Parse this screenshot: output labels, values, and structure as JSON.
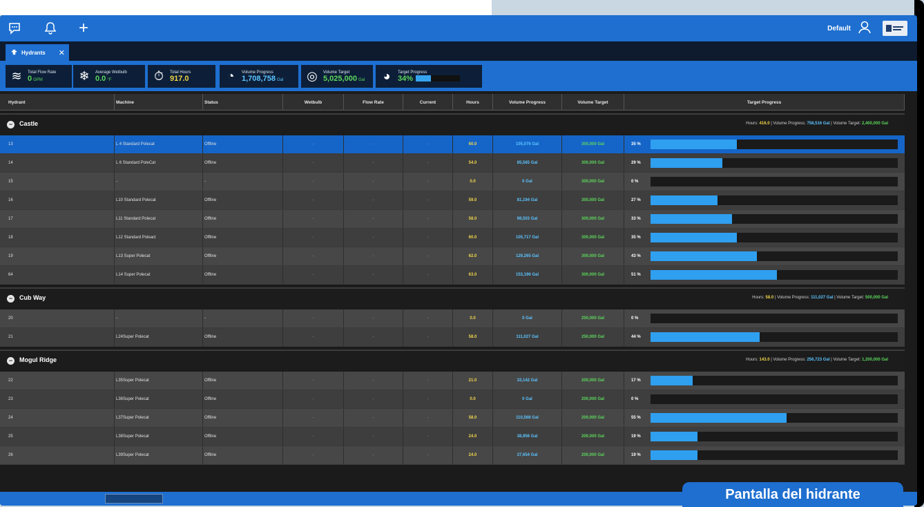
{
  "topbar": {
    "profile_name": "Default",
    "icons": [
      "chat-icon",
      "bell-icon",
      "plus-icon",
      "user-icon"
    ],
    "brand_color": "#1e6fd0"
  },
  "tab": {
    "label": "Hydrants",
    "close": "✕"
  },
  "kpis": [
    {
      "label": "Total Flow Rate",
      "value": "0",
      "unit": "GPM",
      "color": "#5cd65c",
      "icon": "waves-icon"
    },
    {
      "label": "Average Wetbulb",
      "value": "0.0",
      "unit": "°F",
      "color": "#5cd65c",
      "icon": "snowflake-icon"
    },
    {
      "label": "Total Hours",
      "value": "917.0",
      "unit": "",
      "color": "#f1d54a",
      "icon": "stopwatch-icon"
    },
    {
      "label": "Volume Progress",
      "value": "1,708,758",
      "unit": "Gal",
      "color": "#5cc4ff",
      "icon": "gauge-icon"
    },
    {
      "label": "Volume Target",
      "value": "5,025,000",
      "unit": "Gal",
      "color": "#5cd65c",
      "icon": "target-icon"
    },
    {
      "label": "Target Progress",
      "value": "34%",
      "unit": "",
      "color": "#5cd65c",
      "icon": "gauge-check-icon",
      "progress": 0.34
    }
  ],
  "columns": [
    "Hydrant",
    "Machine",
    "Status",
    "Wetbulb",
    "Flow Rate",
    "Current",
    "Hours",
    "Volume Progress",
    "Volume Target",
    "Target Progress"
  ],
  "groups": [
    {
      "name": "Castle",
      "summary": {
        "hours_label": "Hours:",
        "hours": "416.0",
        "vol_label": "Volume Progress:",
        "vol": "758,516 Gal",
        "tgt_label": "Volume Target:",
        "tgt": "2,400,000 Gal"
      },
      "rows": [
        {
          "hydrant": "13",
          "machine": "L 4 Standard Polecat",
          "status": "Offline",
          "wetbulb": "-",
          "flow": "-",
          "current": "-",
          "hours": "60.0",
          "vol": "105,076 Gal",
          "tgt": "300,000 Gal",
          "pct": "35 %",
          "progress": 0.35,
          "selected": true
        },
        {
          "hydrant": "14",
          "machine": "L 6 Standard PoleCat",
          "status": "Offline",
          "wetbulb": "-",
          "flow": "-",
          "current": "-",
          "hours": "54.0",
          "vol": "85,565 Gal",
          "tgt": "300,000 Gal",
          "pct": "29 %",
          "progress": 0.29
        },
        {
          "hydrant": "15",
          "machine": "-",
          "status": "-",
          "wetbulb": "-",
          "flow": "-",
          "current": "-",
          "hours": "0.0",
          "vol": "0 Gal",
          "tgt": "300,000 Gal",
          "pct": "0 %",
          "progress": 0
        },
        {
          "hydrant": "16",
          "machine": "L10 Standard Polecat",
          "status": "Offline",
          "wetbulb": "-",
          "flow": "-",
          "current": "-",
          "hours": "59.0",
          "vol": "81,194 Gal",
          "tgt": "300,000 Gal",
          "pct": "27 %",
          "progress": 0.27
        },
        {
          "hydrant": "17",
          "machine": "L11 Standard Polecat",
          "status": "Offline",
          "wetbulb": "-",
          "flow": "-",
          "current": "-",
          "hours": "58.0",
          "vol": "98,503 Gal",
          "tgt": "300,000 Gal",
          "pct": "33 %",
          "progress": 0.33
        },
        {
          "hydrant": "18",
          "machine": "L12 Standard Poleact",
          "status": "Offline",
          "wetbulb": "-",
          "flow": "-",
          "current": "-",
          "hours": "60.0",
          "vol": "105,717 Gal",
          "tgt": "300,000 Gal",
          "pct": "35 %",
          "progress": 0.35
        },
        {
          "hydrant": "19",
          "machine": "L13 Super Polecat",
          "status": "Offline",
          "wetbulb": "-",
          "flow": "-",
          "current": "-",
          "hours": "62.0",
          "vol": "129,265 Gal",
          "tgt": "300,000 Gal",
          "pct": "43 %",
          "progress": 0.43
        },
        {
          "hydrant": "64",
          "machine": "L14 Super Polecat",
          "status": "Offline",
          "wetbulb": "-",
          "flow": "-",
          "current": "-",
          "hours": "63.0",
          "vol": "153,196 Gal",
          "tgt": "300,000 Gal",
          "pct": "51 %",
          "progress": 0.51
        }
      ]
    },
    {
      "name": "Cub Way",
      "summary": {
        "hours_label": "Hours:",
        "hours": "58.0",
        "vol_label": "Volume Progress:",
        "vol": "111,027 Gal",
        "tgt_label": "Volume Target:",
        "tgt": "500,000 Gal"
      },
      "rows": [
        {
          "hydrant": "20",
          "machine": "-",
          "status": "-",
          "wetbulb": "-",
          "flow": "-",
          "current": "-",
          "hours": "0.0",
          "vol": "0 Gal",
          "tgt": "250,000 Gal",
          "pct": "0 %",
          "progress": 0
        },
        {
          "hydrant": "21",
          "machine": "L24Super Polecat",
          "status": "Offline",
          "wetbulb": "-",
          "flow": "-",
          "current": "-",
          "hours": "58.0",
          "vol": "111,027 Gal",
          "tgt": "250,000 Gal",
          "pct": "44 %",
          "progress": 0.44
        }
      ]
    },
    {
      "name": "Mogul Ridge",
      "summary": {
        "hours_label": "Hours:",
        "hours": "143.0",
        "vol_label": "Volume Progress:",
        "vol": "256,723 Gal",
        "tgt_label": "Volume Target:",
        "tgt": "1,200,000 Gal"
      },
      "rows": [
        {
          "hydrant": "22",
          "machine": "L35Super Polecat",
          "status": "Offline",
          "wetbulb": "-",
          "flow": "-",
          "current": "-",
          "hours": "21.0",
          "vol": "33,142 Gal",
          "tgt": "200,000 Gal",
          "pct": "17 %",
          "progress": 0.17
        },
        {
          "hydrant": "23",
          "machine": "L36Super Polecat",
          "status": "Offline",
          "wetbulb": "-",
          "flow": "-",
          "current": "-",
          "hours": "0.0",
          "vol": "0 Gal",
          "tgt": "200,000 Gal",
          "pct": "0 %",
          "progress": 0
        },
        {
          "hydrant": "24",
          "machine": "L37Super Polecat",
          "status": "Offline",
          "wetbulb": "-",
          "flow": "-",
          "current": "-",
          "hours": "58.0",
          "vol": "110,568 Gal",
          "tgt": "200,000 Gal",
          "pct": "55 %",
          "progress": 0.55
        },
        {
          "hydrant": "25",
          "machine": "L38Super Polecat",
          "status": "Offline",
          "wetbulb": "-",
          "flow": "-",
          "current": "-",
          "hours": "24.0",
          "vol": "38,956 Gal",
          "tgt": "200,000 Gal",
          "pct": "19 %",
          "progress": 0.19
        },
        {
          "hydrant": "26",
          "machine": "L39Super Polecat",
          "status": "Offline",
          "wetbulb": "-",
          "flow": "-",
          "current": "-",
          "hours": "24.0",
          "vol": "37,654 Gal",
          "tgt": "200,000 Gal",
          "pct": "19 %",
          "progress": 0.19
        }
      ]
    }
  ],
  "caption": "Pantalla del hidrante"
}
